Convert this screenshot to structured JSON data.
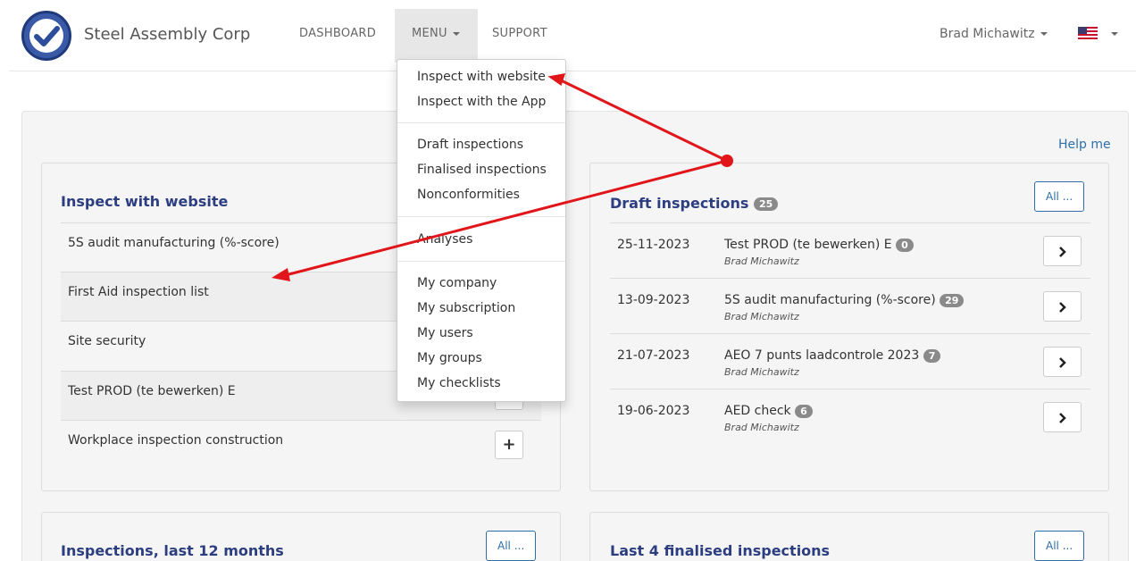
{
  "navbar": {
    "brand": "Steel Assembly Corp",
    "links": [
      "DASHBOARD",
      "MENU",
      "SUPPORT"
    ],
    "user": "Brad Michawitz"
  },
  "help": "Help me",
  "inspect_card": {
    "title": "Inspect with website",
    "items": [
      "5S audit manufacturing (%-score)",
      "First Aid inspection list",
      "Site security",
      "Test PROD (te bewerken) E",
      "Workplace inspection construction"
    ]
  },
  "drafts_card": {
    "title": "Draft inspections",
    "count": "25",
    "all_label": "All ...",
    "rows": [
      {
        "date": "25-11-2023",
        "title": "Test PROD (te bewerken) E",
        "count": "0",
        "user": "Brad Michawitz"
      },
      {
        "date": "13-09-2023",
        "title": "5S audit manufacturing (%-score)",
        "count": "29",
        "user": "Brad Michawitz"
      },
      {
        "date": "21-07-2023",
        "title": "AEO 7 punts laadcontrole 2023",
        "count": "7",
        "user": "Brad Michawitz"
      },
      {
        "date": "19-06-2023",
        "title": "AED check",
        "count": "6",
        "user": "Brad Michawitz"
      }
    ]
  },
  "bottom_left": {
    "title": "Inspections, last 12 months",
    "all_label": "All ..."
  },
  "bottom_right": {
    "title": "Last 4 finalised inspections",
    "all_label": "All ..."
  },
  "menu_dropdown": {
    "group1": [
      "Inspect with website",
      "Inspect with the App"
    ],
    "group2": [
      "Draft inspections",
      "Finalised inspections",
      "Nonconformities"
    ],
    "group3": [
      "Analyses"
    ],
    "group4": [
      "My company",
      "My subscription",
      "My users",
      "My groups",
      "My checklists"
    ]
  },
  "colors": {
    "accent": "#2e6fa8",
    "title": "#2c3e80",
    "annotation": "#e0161b"
  }
}
